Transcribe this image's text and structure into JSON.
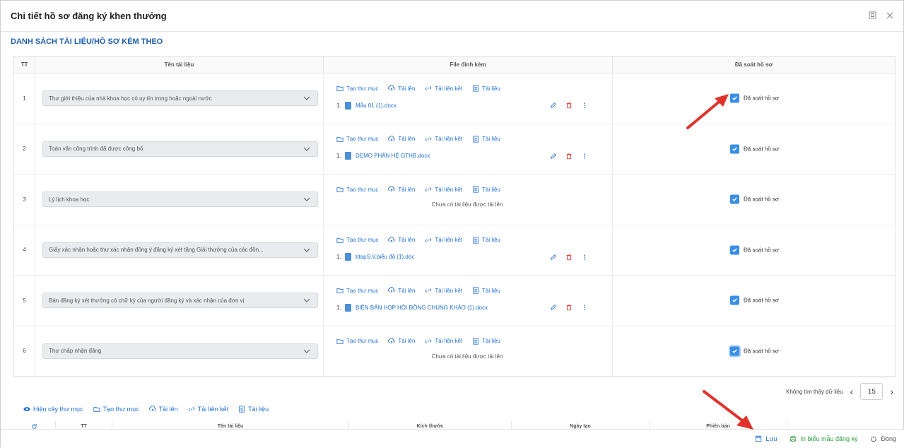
{
  "dialog": {
    "title": "Chi tiết hồ sơ đăng ký khen thưởng",
    "section_title": "DANH SÁCH TÀI LIỆU/HỒ SƠ KÈM THEO"
  },
  "table": {
    "headers": {
      "tt": "TT",
      "name": "Tên tài liệu",
      "file": "File đính kèm",
      "reviewed": "Đã soát hồ sơ"
    },
    "tools": {
      "create_folder": "Tạo thư mục",
      "upload": "Tải lên",
      "upload_link": "Tải liên kết",
      "document": "Tài liệu"
    },
    "empty_message": "Chưa có tài liệu được tải lên",
    "review_label": "Đã soát hồ sơ",
    "rows": [
      {
        "tt": "1",
        "name": "Thư giới thiệu của nhà khoa học có uy tín trong hoặc ngoài nước",
        "file_index": "1.",
        "file_name": "Mẫu 01 (1).docx",
        "has_file": true,
        "reviewed": true
      },
      {
        "tt": "2",
        "name": "Toàn văn công trình đã được công bố",
        "file_index": "1.",
        "file_name": "DEMO PHÂN HỆ GTHB.docx",
        "has_file": true,
        "reviewed": true
      },
      {
        "tt": "3",
        "name": "Lý lịch khoa học",
        "file_index": "",
        "file_name": "",
        "has_file": false,
        "reviewed": true
      },
      {
        "tt": "4",
        "name": "Giấy xác nhận hoặc thư xác nhận đồng ý đăng ký xét tặng Giải thưởng của các đồn...",
        "file_index": "1.",
        "file_name": "btapS,V,biểu đồ (1).doc",
        "has_file": true,
        "reviewed": true
      },
      {
        "tt": "5",
        "name": "Bản đăng ký xét thưởng có chữ ký của người đăng ký và xác nhận của đơn vị",
        "file_index": "1.",
        "file_name": "BIÊN BẢN HỌP HỘI ĐỒNG CHUNG KHẢO (1).docx",
        "has_file": true,
        "reviewed": true
      },
      {
        "tt": "6",
        "name": "Thư chấp nhận đăng",
        "file_index": "",
        "file_name": "",
        "has_file": false,
        "reviewed": true
      }
    ]
  },
  "pager": {
    "label": "Không tìm thấy dữ liệu",
    "page_size": "15"
  },
  "bottom_tools": {
    "show_tree": "Hiện cây thư mục",
    "create_folder": "Tạo thư mục",
    "upload": "Tải lên",
    "upload_link": "Tải liên kết",
    "document": "Tài liệu"
  },
  "sub_table": {
    "tt": "TT",
    "name": "Tên tài liệu",
    "size": "Kích thước",
    "created": "Ngày tạo",
    "version": "Phiên bản"
  },
  "footer": {
    "save": "Lưu",
    "print": "In biểu mẫu đăng ký",
    "close": "Đóng"
  },
  "colors": {
    "accent": "#1f6fd0",
    "print": "#2e9e3e",
    "arrow": "#e0322a"
  }
}
